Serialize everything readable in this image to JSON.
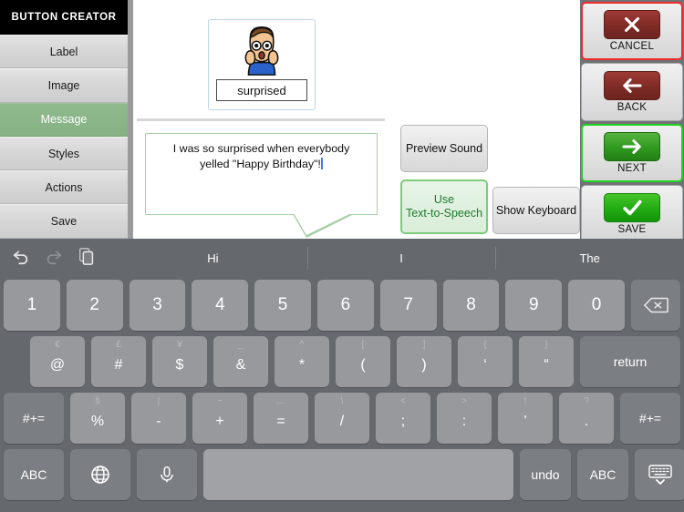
{
  "sidebar": {
    "title": "BUTTON CREATOR",
    "items": [
      {
        "label": "Label",
        "active": false
      },
      {
        "label": "Image",
        "active": false
      },
      {
        "label": "Message",
        "active": true
      },
      {
        "label": "Styles",
        "active": false
      },
      {
        "label": "Actions",
        "active": false
      },
      {
        "label": "Save",
        "active": false
      }
    ]
  },
  "center": {
    "image_card": {
      "label": "surprised",
      "icon": "surprised-face-pictogram"
    },
    "message": {
      "text": "I was so surprised when everybody yelled \"Happy Birthday\"!",
      "has_caret": true
    }
  },
  "middle_buttons": {
    "preview_sound": "Preview Sound",
    "use_tts_line1": "Use",
    "use_tts_line2": "Text-to-Speech",
    "show_keyboard": "Show Keyboard"
  },
  "actions": [
    {
      "label": "CANCEL",
      "icon": "close-x-icon",
      "selected": "red"
    },
    {
      "label": "BACK",
      "icon": "arrow-left-icon",
      "selected": "none"
    },
    {
      "label": "NEXT",
      "icon": "arrow-right-icon",
      "selected": "green"
    },
    {
      "label": "SAVE",
      "icon": "checkmark-icon",
      "selected": "none"
    }
  ],
  "colors": {
    "accent_green": "#21d421",
    "accent_red": "#ef2b2b",
    "sidebar_active": "#8fba8d",
    "caret": "#3d7fe8",
    "keyboard_bg": "#65696d",
    "key_bg": "#97999c"
  },
  "keyboard": {
    "suggestions": [
      "Hi",
      "I",
      "The"
    ],
    "suggestion_icons": [
      "undo-icon",
      "redo-icon",
      "paste-icon"
    ],
    "row_numbers": [
      "1",
      "2",
      "3",
      "4",
      "5",
      "6",
      "7",
      "8",
      "9",
      "0"
    ],
    "backspace": "backspace-icon",
    "row_symbols": [
      {
        "hint": "€",
        "main": "@"
      },
      {
        "hint": "£",
        "main": "#"
      },
      {
        "hint": "¥",
        "main": "$"
      },
      {
        "hint": "_",
        "main": "&"
      },
      {
        "hint": "^",
        "main": "*"
      },
      {
        "hint": "[",
        "main": "("
      },
      {
        "hint": "]",
        "main": ")"
      },
      {
        "hint": "{",
        "main": "‘"
      },
      {
        "hint": "}",
        "main": "“"
      }
    ],
    "return_label": "return",
    "row_alt_left": "#+=",
    "row_alt_right": "#+=",
    "row_alt": [
      {
        "hint": "§",
        "main": "%"
      },
      {
        "hint": "|",
        "main": "-"
      },
      {
        "hint": "~",
        "main": "+"
      },
      {
        "hint": "…",
        "main": "="
      },
      {
        "hint": "\\",
        "main": "/"
      },
      {
        "hint": "<",
        "main": ";"
      },
      {
        "hint": ">",
        "main": ":"
      },
      {
        "hint": "!",
        "main": "’"
      },
      {
        "hint": "?",
        "main": "."
      }
    ],
    "bottom": {
      "abc_left": "ABC",
      "globe": "globe-icon",
      "mic": "microphone-icon",
      "space": "",
      "undo": "undo",
      "abc_right": "ABC",
      "hide": "hide-keyboard-icon"
    }
  }
}
